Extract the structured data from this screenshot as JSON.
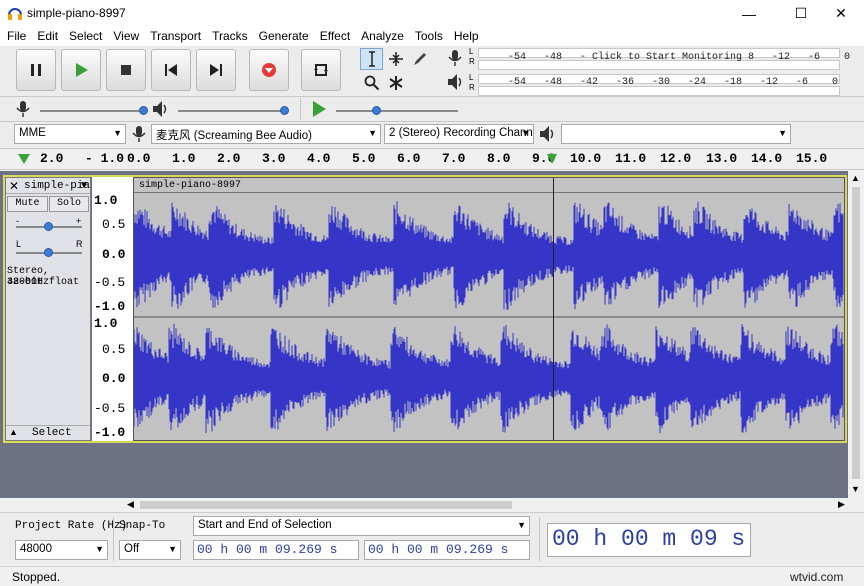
{
  "window": {
    "title": "simple-piano-8997"
  },
  "menu": [
    "File",
    "Edit",
    "Select",
    "View",
    "Transport",
    "Tracks",
    "Generate",
    "Effect",
    "Analyze",
    "Tools",
    "Help"
  ],
  "meters": {
    "record_scale": "-54   -48   - Click to Start Monitoring 8   -12   -6    0",
    "play_scale": "-54   -48   -42   -36   -30   -24   -18   -12   -6    0",
    "channel_l": "L",
    "channel_r": "R"
  },
  "device": {
    "host": "MME",
    "input": "麦克风 (Screaming Bee Audio)",
    "channels": "2 (Stereo) Recording Chann",
    "output": ""
  },
  "ruler": [
    "2.0",
    "- 1.0",
    "0.0",
    "1.0",
    "2.0",
    "3.0",
    "4.0",
    "5.0",
    "6.0",
    "7.0",
    "8.0",
    "9.0",
    "10.0",
    "11.0",
    "12.0",
    "13.0",
    "14.0",
    "15.0"
  ],
  "track": {
    "name": "simple-pia",
    "clip_name": "simple-piano-8997",
    "mute_label": "Mute",
    "solo_label": "Solo",
    "gain_left": "-",
    "gain_right": "+",
    "pan_left": "L",
    "pan_right": "R",
    "info_line1": "Stereo, 48000Hz",
    "info_line2": "32-bit float",
    "select_label": "Select",
    "scale": [
      "1.0",
      "0.5",
      "0.0",
      "-0.5",
      "-1.0"
    ]
  },
  "selection": {
    "rate_label": "Project Rate (Hz)",
    "rate_value": "48000",
    "snap_label": "Snap-To",
    "snap_value": "Off",
    "mode_value": "Start and End of Selection",
    "start_time": "00 h 00 m 09.269 s",
    "end_time": "00 h 00 m 09.269 s",
    "audio_pos": "00 h 00 m 09 s"
  },
  "status": {
    "text": "Stopped."
  },
  "watermark": "wtvid.com",
  "colors": {
    "wave": "#3535c8",
    "wave_bg": "#c2c2c2",
    "track_bg": "#6c7183"
  }
}
